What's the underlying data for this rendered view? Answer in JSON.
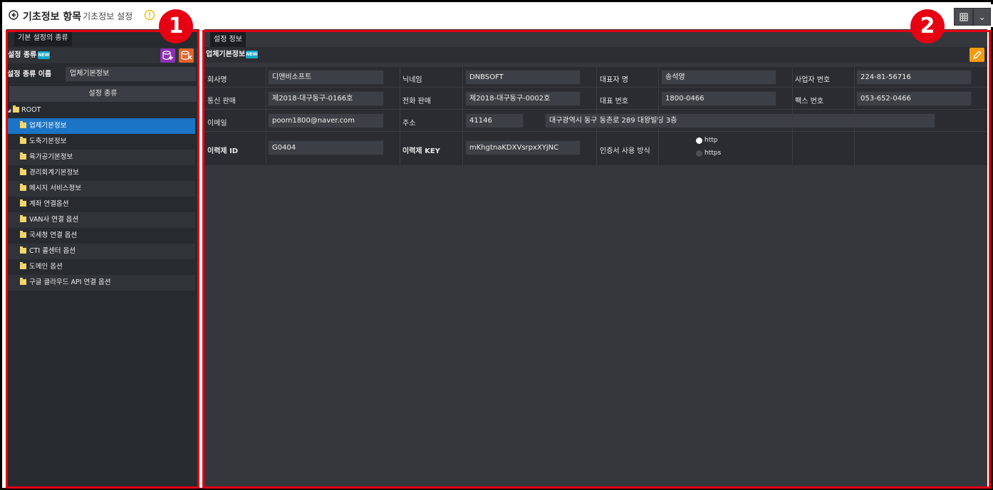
{
  "titlebar": {
    "title": "기초정보 항목",
    "subtitle": "- 기초정보 설정"
  },
  "left": {
    "tab": "기본 설정의 종류",
    "header_label": "설정 종류",
    "badge": "NEW",
    "name_label": "설정 종류 이름",
    "name_value": "업체기본정보",
    "tree_header": "설정 종류",
    "tree": [
      {
        "label": "ROOT"
      },
      {
        "label": "업체기본정보"
      },
      {
        "label": "도축기본정보"
      },
      {
        "label": "육가공기본정보"
      },
      {
        "label": "경리회계기본정보"
      },
      {
        "label": "메시지 서비스정보"
      },
      {
        "label": "계좌 연결옵션"
      },
      {
        "label": "VAN사 연결 옵션"
      },
      {
        "label": "국세청 연결 옵션"
      },
      {
        "label": "CTI 콜센터 옵션"
      },
      {
        "label": "도메인 옵션"
      },
      {
        "label": "구글 클라우드 API 연결 옵션"
      }
    ]
  },
  "right": {
    "tab": "설정 정보",
    "header_label": "업체기본정보",
    "badge": "NEW",
    "form": {
      "company_label": "회사명",
      "company_value": "디앤비소프트",
      "nick_label": "닉네임",
      "nick_value": "DNBSOFT",
      "ceo_label": "대표자 명",
      "ceo_value": "송석영",
      "bizno_label": "사업자 번호",
      "bizno_value": "224-81-56716",
      "mail_order_label": "통신 판매",
      "mail_order_value": "제2018-대구동구-0166호",
      "phone_sales_label": "전화 판매",
      "phone_sales_value": "제2018-대구동구-0002호",
      "rep_phone_label": "대표 번호",
      "rep_phone_value": "1800-0466",
      "fax_label": "팩스 번호",
      "fax_value": "053-652-0466",
      "email_label": "이메일",
      "email_value": "poom1800@naver.com",
      "address_label": "주소",
      "zip_value": "41146",
      "address_value": "대구광역시 동구 동촌로 289 대왕빌딩 3층",
      "trace_id_label": "이력제 ID",
      "trace_id_value": "G0404",
      "trace_key_label": "이력제 KEY",
      "trace_key_value": "mKhgtnaKDXVsrpxXYjNC",
      "cert_label": "인증서 사용 방식",
      "cert_options": [
        "http",
        "https"
      ],
      "cert_selected": "http"
    }
  },
  "annotations": {
    "one": "1",
    "two": "2"
  },
  "colors": {
    "selected": "#1b74c5",
    "annotation_red": "#e60012",
    "edit_orange": "#f39c12",
    "add_purple": "#8e2fb5",
    "delete_orange": "#e0642a",
    "badge_cyan": "#15a8c8"
  }
}
